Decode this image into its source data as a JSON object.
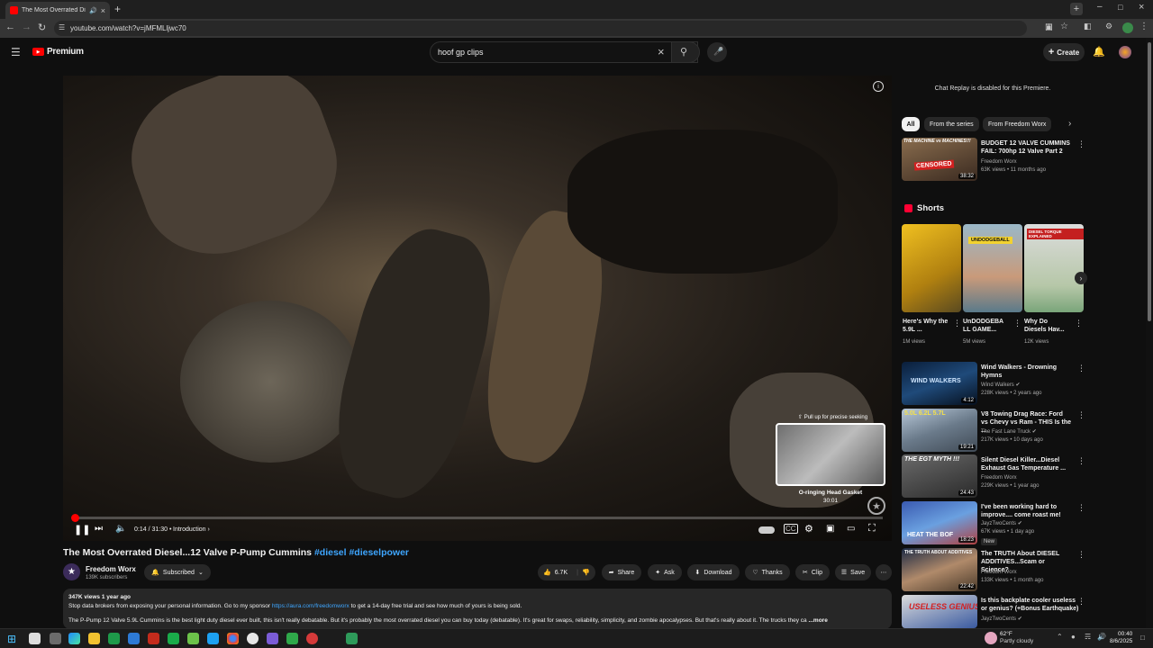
{
  "browser": {
    "tab_title": "The Most Overrated Diesel...",
    "url": "youtube.com/watch?v=jMFMLljwc70"
  },
  "header": {
    "logo_label": "Premium",
    "search_value": "hoof gp clips",
    "create_label": "Create"
  },
  "player": {
    "time": "0:14 / 31:30",
    "chapter": "Introduction",
    "progress_fraction": 0.0074,
    "seek_tip": "Pull up for precise seeking",
    "preview_title": "O-ringing Head Gasket",
    "preview_time": "30:01"
  },
  "video": {
    "title": "The Most Overrated Diesel...12 Valve P-Pump Cummins",
    "tags": "#diesel #dieselpower",
    "channel": "Freedom Worx",
    "subscribers": "139K subscribers",
    "subscribed_label": "Subscribed",
    "likes": "6.7K",
    "share": "Share",
    "ask": "Ask",
    "download": "Download",
    "thanks": "Thanks",
    "clip": "Clip",
    "save": "Save"
  },
  "description": {
    "stats": "347K views  1 year ago",
    "line1_a": "Stop data brokers from exposing your personal information. Go to my sponsor ",
    "line1_link": "https://aura.com/freedomworx",
    "line1_b": " to get a 14-day free trial and see how much of yours is being sold.",
    "line2": "The P-Pump 12 Valve 5.9L Cummins is the best light duty diesel ever built, this isn't really debatable. But it's probably the most overrated diesel you can buy today (debatable). It's great for swaps, reliability, simplicity, and zombie apocalypses. But that's really about it. The trucks they ca",
    "more": "...more"
  },
  "sidebar": {
    "chat_replay": "Chat Replay is disabled for this Premiere.",
    "chips": [
      "All",
      "From the series",
      "From Freedom Worx"
    ],
    "top_video": {
      "title": "BUDGET 12 VALVE CUMMINS FAIL: 700hp 12 Valve Part 2",
      "channel": "Freedom Worx",
      "meta": "63K views • 11 months ago",
      "duration": "38:32",
      "thumb_text": "THE MACHINE vs MACHINES!!!",
      "badge": "CENSORED"
    },
    "shorts_label": "Shorts",
    "shorts": [
      {
        "title": "Here's Why the 5.9L ...",
        "views": "1M views",
        "thumb_text": ""
      },
      {
        "title": "UnDODGEBA LL GAME...",
        "views": "5M views",
        "thumb_text": "UNDODGEBALL"
      },
      {
        "title": "Why Do Diesels Hav...",
        "views": "12K views",
        "thumb_text": "DIESEL TORQUE EXPLAINED"
      }
    ],
    "videos": [
      {
        "title": "Wind Walkers - Drowning Hymns",
        "channel": "Wind Walkers",
        "meta": "228K views • 2 years ago",
        "duration": "4:12",
        "thumb_text": "WIND WALKERS",
        "badge": ""
      },
      {
        "title": "V8 Towing Drag Race: Ford vs Chevy vs Ram - THIS Is the ...",
        "channel": "The Fast Lane Truck",
        "meta": "217K views • 10 days ago",
        "duration": "19:21",
        "thumb_text": "5.0L 6.2L 5.7L",
        "badge": ""
      },
      {
        "title": "Silent Diesel Killer...Diesel Exhaust Gas Temperature ...",
        "channel": "Freedom Worx",
        "meta": "229K views • 1 year ago",
        "duration": "24:43",
        "thumb_text": "THE EGT MYTH !!!",
        "badge": ""
      },
      {
        "title": "I've been working hard to improve.... come roast me!",
        "channel": "JayzTwoCents",
        "meta": "67K views • 1 day ago",
        "duration": "18:23",
        "thumb_text": "HEAT THE BOF",
        "badge": "New"
      },
      {
        "title": "The TRUTH About DIESEL ADDITIVES...Scam or Science?",
        "channel": "Freedom Worx",
        "meta": "133K views • 1 month ago",
        "duration": "22:42",
        "thumb_text": "THE TRUTH ABOUT ADDITIVES",
        "badge": ""
      },
      {
        "title": "Is this backplate cooler useless or genius? (+Bonus Earthquake)",
        "channel": "JayzTwoCents",
        "meta": "",
        "duration": "",
        "thumb_text": "USELESS GENIUS",
        "badge": ""
      }
    ]
  },
  "taskbar": {
    "weather_temp": "62°F",
    "weather_desc": "Partly cloudy",
    "time": "00:40",
    "date": "8/6/2025"
  }
}
